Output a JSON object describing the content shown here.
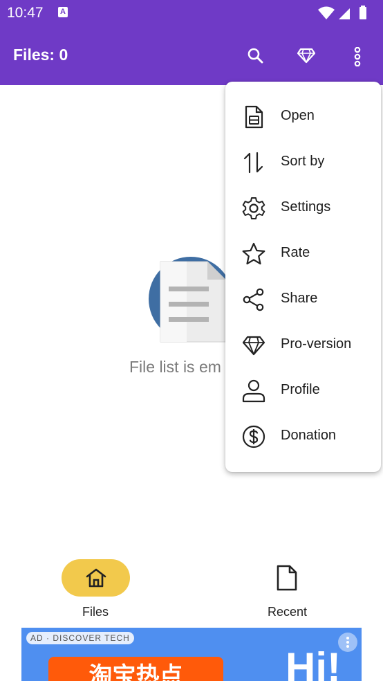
{
  "status_bar": {
    "time": "10:47",
    "notification_icon": "a-icon"
  },
  "app_bar": {
    "title": "Files: 0",
    "icons": [
      "search-icon",
      "diamond-icon",
      "more-vert-icon"
    ]
  },
  "empty_state": {
    "text": "File list is em"
  },
  "menu": {
    "items": [
      {
        "label": "Open",
        "icon": "file-open-icon"
      },
      {
        "label": "Sort by",
        "icon": "sort-icon"
      },
      {
        "label": "Settings",
        "icon": "gear-icon"
      },
      {
        "label": "Rate",
        "icon": "star-icon"
      },
      {
        "label": "Share",
        "icon": "share-icon"
      },
      {
        "label": "Pro-version",
        "icon": "diamond-icon"
      },
      {
        "label": "Profile",
        "icon": "person-icon"
      },
      {
        "label": "Donation",
        "icon": "dollar-icon"
      }
    ]
  },
  "bottom_nav": {
    "tabs": [
      {
        "label": "Files",
        "icon": "home-icon",
        "active": true
      },
      {
        "label": "Recent",
        "icon": "document-icon",
        "active": false
      }
    ]
  },
  "ad": {
    "tag": "AD · DISCOVER TECH",
    "promo": "淘宝热点",
    "headline": "Hi!"
  },
  "colors": {
    "primary": "#6f3ac6",
    "accent": "#f2c94c",
    "ad_background": "#4f8ff0",
    "promo": "#ff5a0a"
  }
}
